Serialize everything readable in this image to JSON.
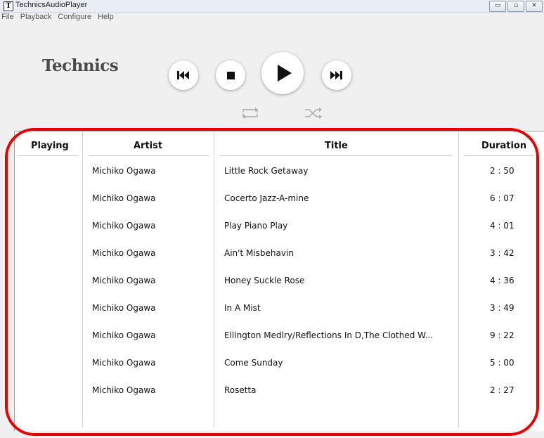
{
  "window": {
    "icon_letter": "T",
    "title": "TechnicsAudioPlayer",
    "buttons": [
      "minimize-button",
      "maximize-button",
      "close-button"
    ]
  },
  "menu": [
    "File",
    "Playback",
    "Configure",
    "Help"
  ],
  "brand": "Technics",
  "controls": [
    "previous-track",
    "stop",
    "play",
    "next-track",
    "repeat",
    "shuffle"
  ],
  "table": {
    "headers": {
      "playing": "Playing",
      "artist": "Artist",
      "title": "Title",
      "duration": "Duration"
    },
    "rows": [
      {
        "artist": "Michiko Ogawa",
        "title": "Little Rock Getaway",
        "duration": "2 : 50"
      },
      {
        "artist": "Michiko Ogawa",
        "title": "Cocerto Jazz-A-mine",
        "duration": "6 : 07"
      },
      {
        "artist": "Michiko Ogawa",
        "title": "Play Piano Play",
        "duration": "4 : 01"
      },
      {
        "artist": "Michiko Ogawa",
        "title": "Ain't Misbehavin",
        "duration": "3 : 42"
      },
      {
        "artist": "Michiko Ogawa",
        "title": "Honey Suckle Rose",
        "duration": "4 : 36"
      },
      {
        "artist": "Michiko Ogawa",
        "title": "In A Mist",
        "duration": "3 : 49"
      },
      {
        "artist": "Michiko Ogawa",
        "title": "Ellington Medlry/Reflections In D,The Clothed W...",
        "duration": "9 : 22"
      },
      {
        "artist": "Michiko Ogawa",
        "title": "Come Sunday",
        "duration": "5 : 00"
      },
      {
        "artist": "Michiko Ogawa",
        "title": "Rosetta",
        "duration": "2 : 27"
      }
    ]
  },
  "colors": {
    "highlight": "#e60000",
    "brand_text": "#4a4a4a"
  }
}
